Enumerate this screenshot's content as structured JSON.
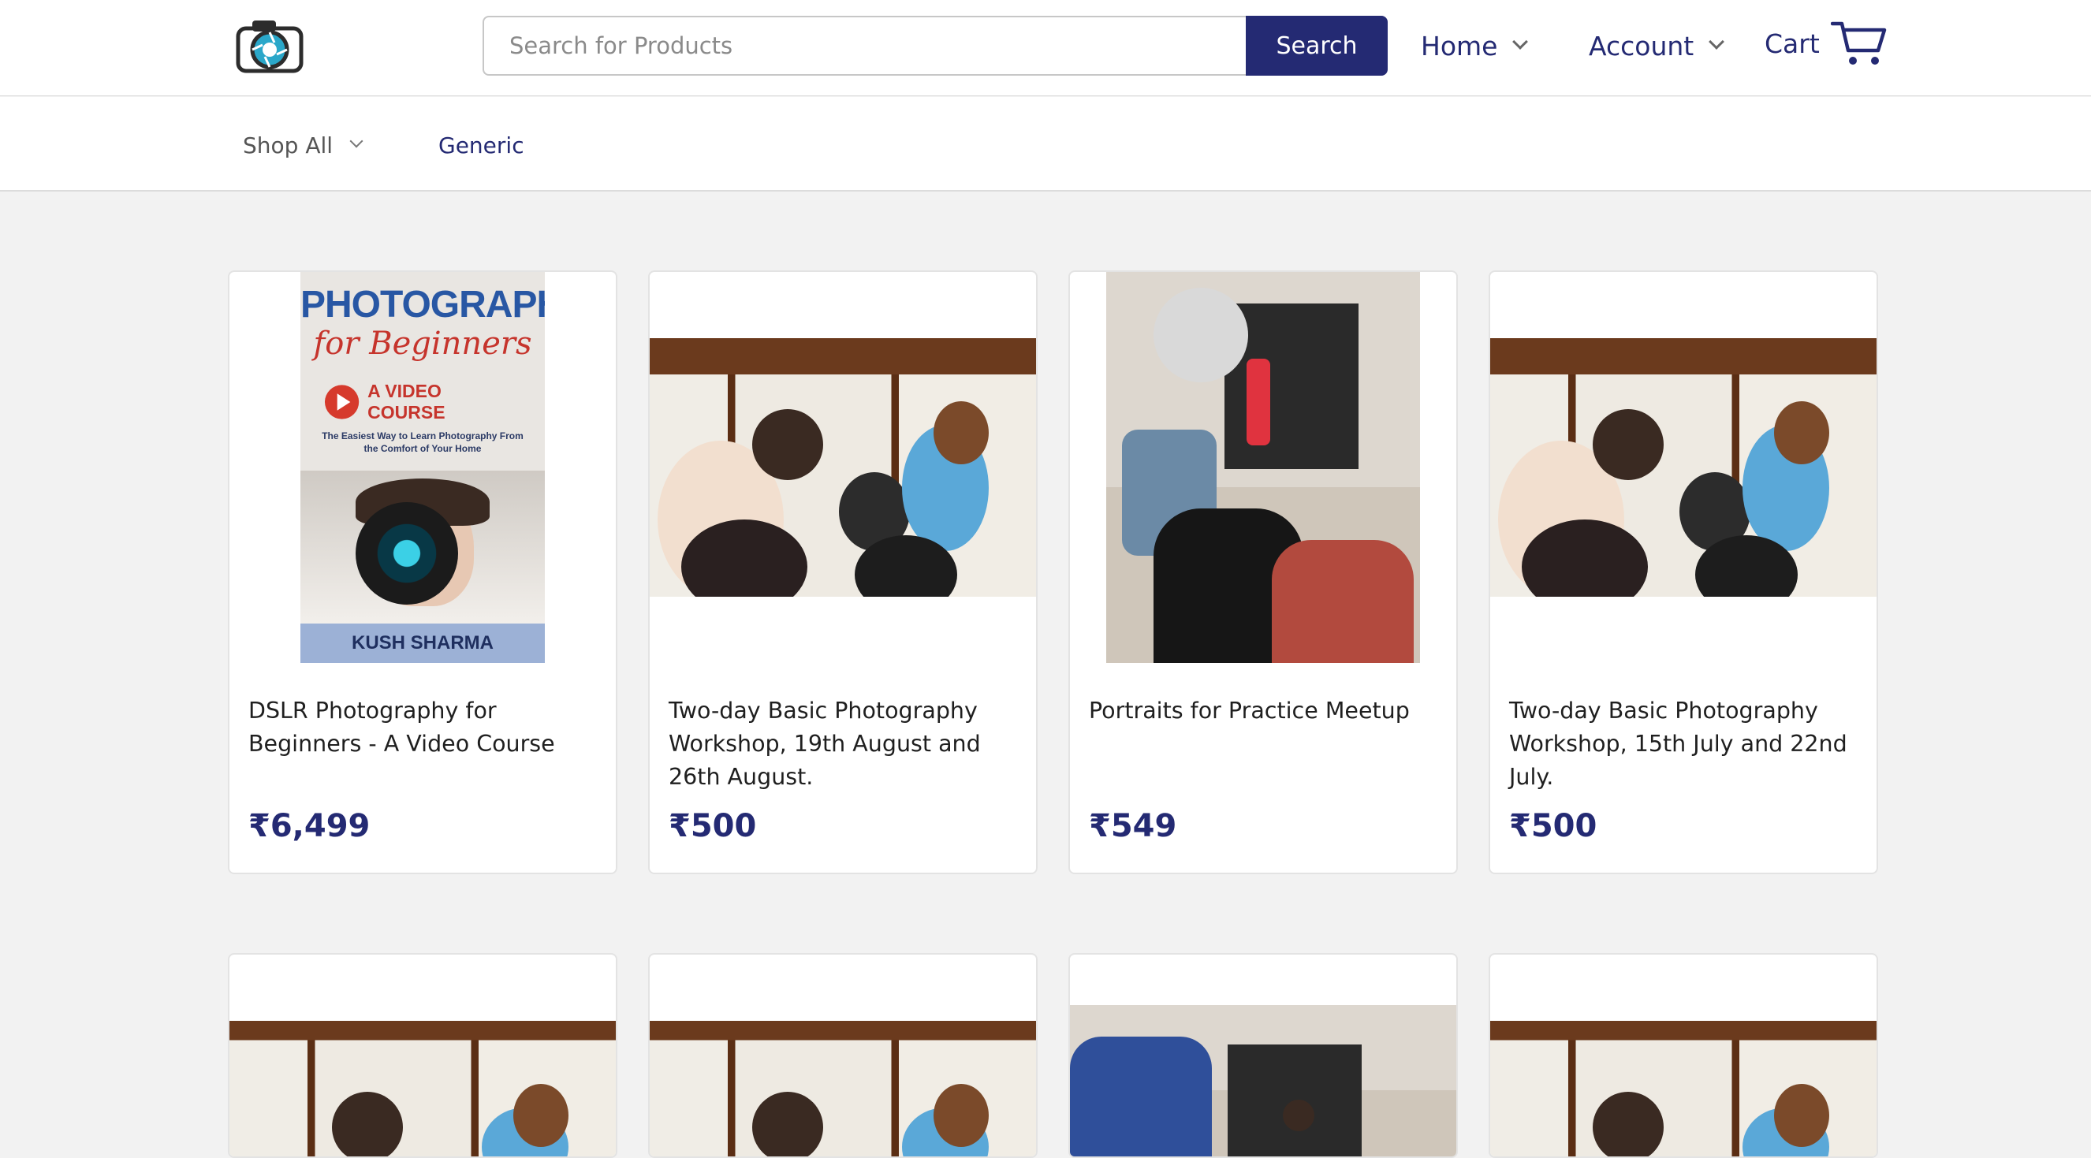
{
  "header": {
    "logo_icon": "camera-shutter-icon",
    "search": {
      "placeholder": "Search for Products",
      "value": "",
      "button_label": "Search"
    },
    "nav": {
      "home_label": "Home",
      "account_label": "Account",
      "cart_label": "Cart",
      "cart_icon": "cart-icon"
    }
  },
  "subnav": {
    "shop_all_label": "Shop All",
    "generic_label": "Generic"
  },
  "colors": {
    "brand": "#242a73",
    "page_bg": "#f2f2f2",
    "card_border": "#e3e3e3"
  },
  "products": [
    {
      "title": "DSLR Photography for Beginners - A Video Course",
      "price": "₹6,499",
      "cover": {
        "line1": "PHOTOGRAPHY",
        "line2": "for Beginners",
        "badge": "A VIDEO COURSE",
        "tagline": "The Easiest Way to Learn Photography From the Comfort of Your Home",
        "author": "KUSH SHARMA"
      }
    },
    {
      "title": "Two-day Basic Photography Workshop, 19th August and 26th August.",
      "price": "₹500"
    },
    {
      "title": "Portraits for Practice Meetup",
      "price": "₹549"
    },
    {
      "title": "Two-day Basic Photography Workshop, 15th July and 22nd July.",
      "price": "₹500"
    }
  ]
}
